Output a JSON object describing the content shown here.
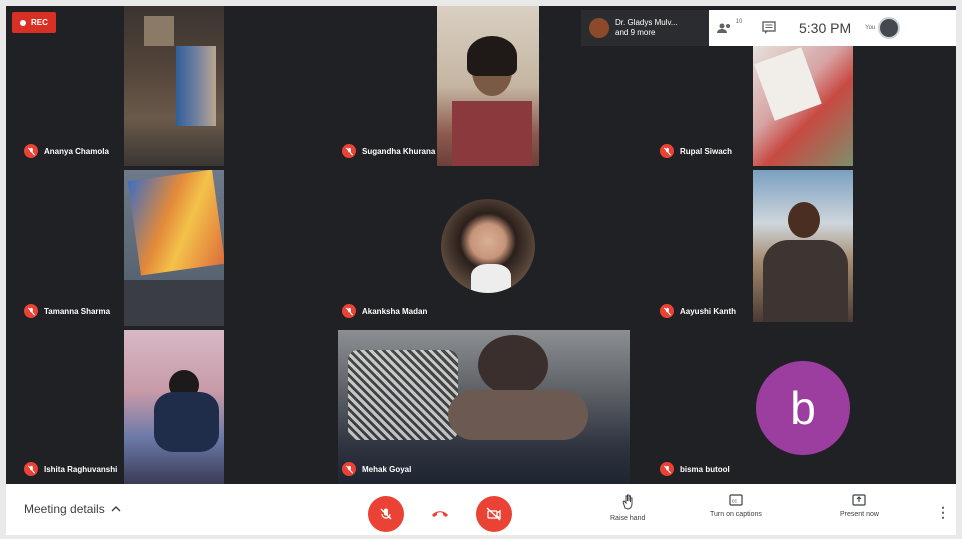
{
  "recording": {
    "label": "REC"
  },
  "header": {
    "participants_chip": {
      "line1": "Dr. Gladys Mulv...",
      "line2": "and 9 more"
    },
    "participant_count": "10",
    "time": "5:30 PM",
    "you_label": "You"
  },
  "tiles": [
    {
      "name": "Ananya Chamola"
    },
    {
      "name": "Sugandha Khurana"
    },
    {
      "name": "Rupal Siwach"
    },
    {
      "name": "Tamanna Sharma"
    },
    {
      "name": "Akanksha Madan"
    },
    {
      "name": "Aayushi Kanth"
    },
    {
      "name": "Ishita Raghuvanshi"
    },
    {
      "name": "Mehak Goyal"
    },
    {
      "name": "bisma butool",
      "initial": "b"
    }
  ],
  "bottom": {
    "meeting_details": "Meeting details",
    "raise_hand": "Raise hand",
    "captions": "Turn on captions",
    "present": "Present now",
    "more": "⋮"
  },
  "colors": {
    "bar_red": "#ea4335",
    "tile_bg": "#202124",
    "avatar_purple": "#9c3ea0"
  }
}
